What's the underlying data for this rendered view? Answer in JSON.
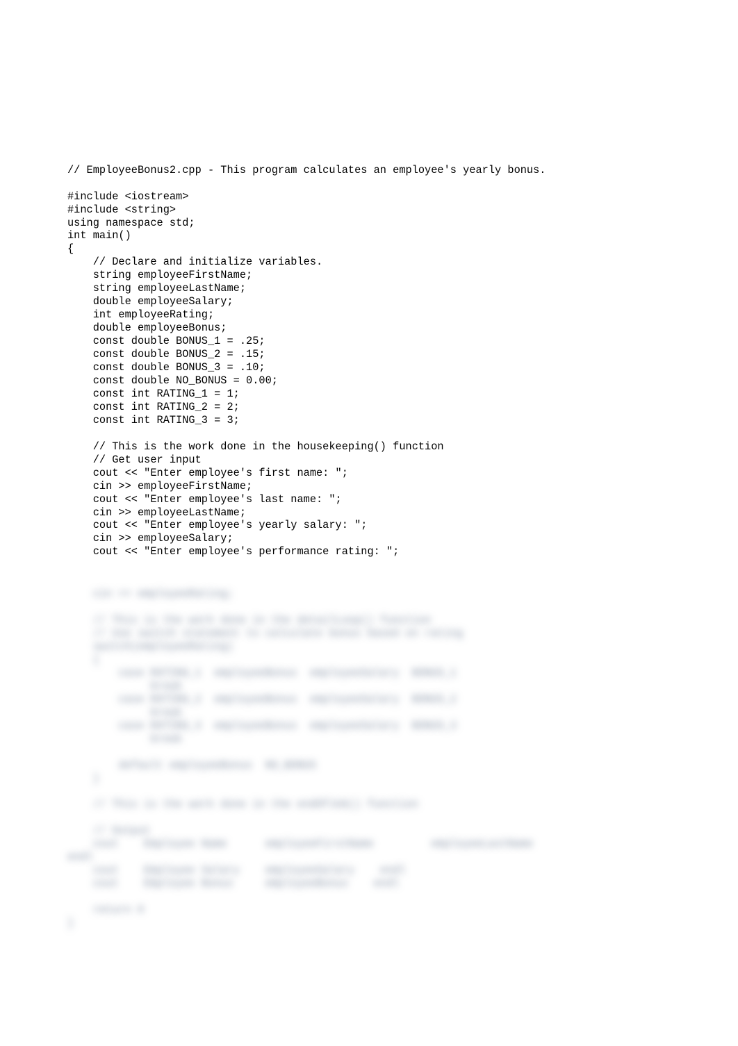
{
  "code_lines": [
    "// EmployeeBonus2.cpp - This program calculates an employee's yearly bonus.",
    "",
    "#include <iostream>",
    "#include <string>",
    "using namespace std;",
    "int main()",
    "{",
    "    // Declare and initialize variables.",
    "    string employeeFirstName;",
    "    string employeeLastName;",
    "    double employeeSalary;",
    "    int employeeRating;",
    "    double employeeBonus;",
    "    const double BONUS_1 = .25;",
    "    const double BONUS_2 = .15;",
    "    const double BONUS_3 = .10;",
    "    const double NO_BONUS = 0.00;",
    "    const int RATING_1 = 1;",
    "    const int RATING_2 = 2;",
    "    const int RATING_3 = 3;",
    "",
    "    // This is the work done in the housekeeping() function",
    "    // Get user input",
    "    cout << \"Enter employee's first name: \";",
    "    cin >> employeeFirstName;",
    "    cout << \"Enter employee's last name: \";",
    "    cin >> employeeLastName;",
    "    cout << \"Enter employee's yearly salary: \";",
    "    cin >> employeeSalary;",
    "    cout << \"Enter employee's performance rating: \";"
  ],
  "blurred_lines": [
    "    cin >> employeeRating;",
    "",
    "    // This is the work done in the detailLoop() function",
    "    // Use switch statement to calculate bonus based on rating",
    "    switch(employeeRating)",
    "    {",
    "        case RATING_1  employeeBonus  employeeSalary  BONUS_1",
    "             break",
    "        case RATING_2  employeeBonus  employeeSalary  BONUS_2",
    "             break",
    "        case RATING_3  employeeBonus  employeeSalary  BONUS_3",
    "             break",
    "",
    "        default employeeBonus  NO_BONUS",
    "    }",
    "",
    "    // This is the work done in the endOfJob() function",
    "",
    "    // Output",
    "    cout    Employee Name      employeeFirstName         employeeLastName   ",
    "endl",
    "    cout    Employee Salary    employeeSalary    endl",
    "    cout    Employee Bonus     employeeBonus    endl",
    "",
    "    return 0",
    "}"
  ]
}
